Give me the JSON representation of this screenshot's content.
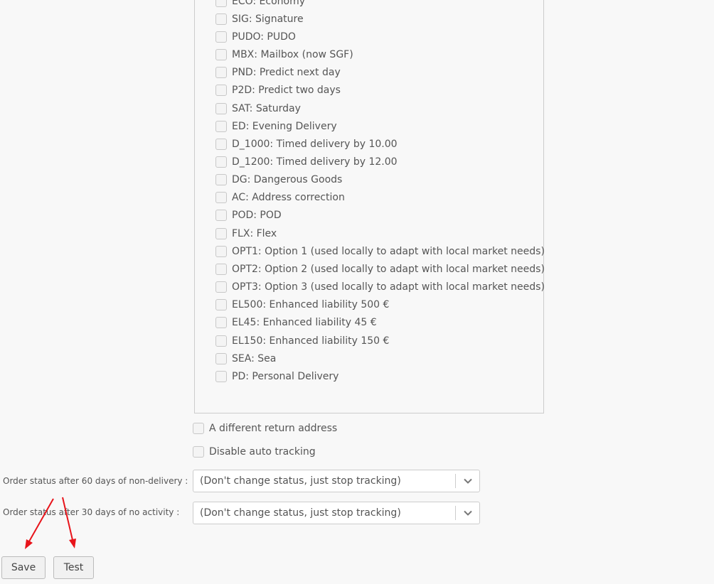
{
  "services": {
    "items": [
      {
        "code_label": "ECO: Economy"
      },
      {
        "code_label": "SIG: Signature"
      },
      {
        "code_label": "PUDO: PUDO"
      },
      {
        "code_label": "MBX: Mailbox (now SGF)"
      },
      {
        "code_label": "PND: Predict next day"
      },
      {
        "code_label": "P2D: Predict two days"
      },
      {
        "code_label": "SAT: Saturday"
      },
      {
        "code_label": "ED: Evening Delivery"
      },
      {
        "code_label": "D_1000: Timed delivery by 10.00"
      },
      {
        "code_label": "D_1200: Timed delivery by 12.00"
      },
      {
        "code_label": "DG: Dangerous Goods"
      },
      {
        "code_label": "AC: Address correction"
      },
      {
        "code_label": "POD: POD"
      },
      {
        "code_label": "FLX: Flex"
      },
      {
        "code_label": "OPT1: Option 1 (used locally to adapt with local market needs)"
      },
      {
        "code_label": "OPT2: Option 2 (used locally to adapt with local market needs)"
      },
      {
        "code_label": "OPT3: Option 3 (used locally to adapt with local market needs)"
      },
      {
        "code_label": "EL500: Enhanced liability 500 €"
      },
      {
        "code_label": "EL45: Enhanced liability 45 €"
      },
      {
        "code_label": "EL150: Enhanced liability 150 €"
      },
      {
        "code_label": "SEA: Sea"
      },
      {
        "code_label": "PD: Personal Delivery"
      }
    ]
  },
  "options": {
    "return_address_label": "A different return address",
    "disable_tracking_label": "Disable auto tracking"
  },
  "fields": {
    "non_delivery": {
      "label": "Order status after 60 days of non-delivery :",
      "value": "(Don't change status, just stop tracking)"
    },
    "no_activity": {
      "label": "Order status after 30 days of no activity :",
      "value": "(Don't change status, just stop tracking)"
    }
  },
  "buttons": {
    "save_label": "Save",
    "test_label": "Test"
  },
  "icons": {
    "select_arrow": "chevron-down-icon",
    "annotation": "red-arrow-icon"
  },
  "colors": {
    "annotation_red": "#e8141b",
    "background": "#f8f8f8"
  }
}
